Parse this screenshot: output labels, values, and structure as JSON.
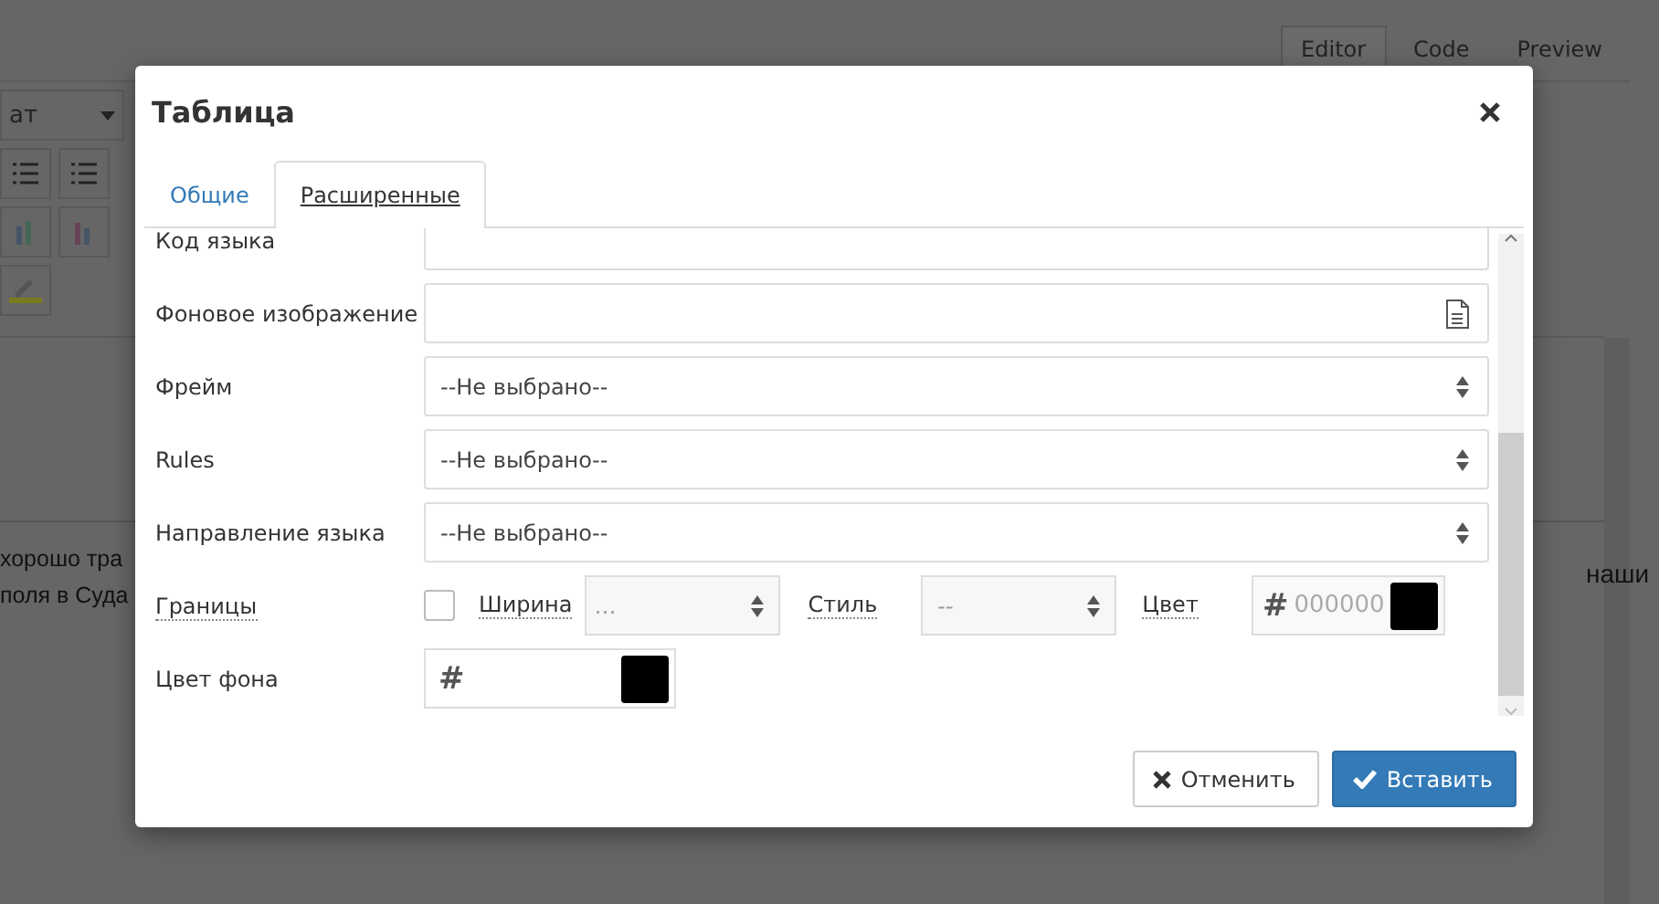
{
  "background": {
    "view_tabs": [
      {
        "label": "Editor",
        "selected": true
      },
      {
        "label": "Code",
        "selected": false
      },
      {
        "label": "Preview",
        "selected": false
      }
    ],
    "format_dropdown": "ат",
    "text_lines": [
      "хорошо тра",
      "поля в Суда"
    ],
    "right_text": "наши"
  },
  "dialog": {
    "title": "Таблица",
    "tabs": [
      {
        "label": "Общие",
        "selected": false
      },
      {
        "label": "Расширенные",
        "selected": true
      }
    ],
    "fields": [
      {
        "kind": "text",
        "label": "Код языка"
      },
      {
        "kind": "file",
        "label": "Фоновое изображение"
      },
      {
        "kind": "select",
        "label": "Фрейм",
        "value": "--Не выбрано--"
      },
      {
        "kind": "select",
        "label": "Rules",
        "value": "--Не выбрано--"
      },
      {
        "kind": "select",
        "label": "Направление языка",
        "value": "--Не выбрано--"
      },
      {
        "kind": "border",
        "label": "Границы",
        "checked": false,
        "width_label": "Ширина",
        "width_value": "…",
        "style_label": "Стиль",
        "style_value": "--",
        "color_label": "Цвет",
        "hash": "#",
        "color_placeholder": "000000",
        "color": "#000000"
      },
      {
        "kind": "color",
        "label": "Цвет фона",
        "hash": "#",
        "color": "#000000"
      }
    ],
    "buttons": [
      {
        "kind": "cancel",
        "label": "Отменить"
      },
      {
        "kind": "insert",
        "label": "Вставить"
      }
    ]
  }
}
